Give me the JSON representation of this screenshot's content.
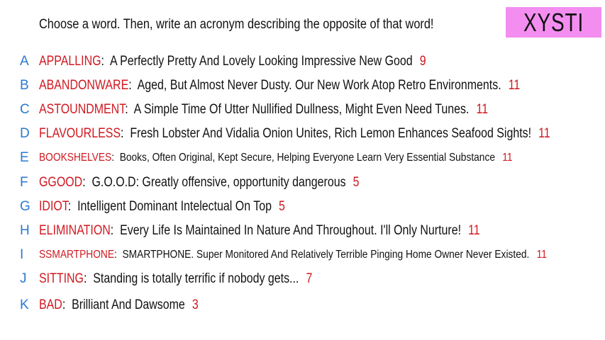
{
  "prompt": "Choose a word. Then, write an acronym describing the opposite of that word!",
  "badge": "XYSTI",
  "colors": {
    "badge": "#f38ef0",
    "letter": "#2a7ad1",
    "word": "#d01820"
  },
  "entries": [
    {
      "letter": "A",
      "word": "APPALLING",
      "acronym": "A Perfectly Pretty And Lovely Looking Impressive New Good",
      "score": "9"
    },
    {
      "letter": "B",
      "word": "ABANDONWARE",
      "acronym": "Aged, But Almost Never Dusty. Our New Work Atop Retro Environments.",
      "score": "11"
    },
    {
      "letter": "C",
      "word": "ASTOUNDMENT",
      "acronym": "A Simple Time Of Utter Nullified Dullness, Might Even Need Tunes.",
      "score": "11"
    },
    {
      "letter": "D",
      "word": "FLAVOURLESS",
      "acronym": "Fresh Lobster And Vidalia Onion Unites, Rich Lemon Enhances Seafood Sights!",
      "score": "11"
    },
    {
      "letter": "E",
      "word": "BOOKSHELVES",
      "acronym": "Books, Often Original, Kept Secure, Helping Everyone Learn Very Essential Substance",
      "score": "11"
    },
    {
      "letter": "F",
      "word": "GGOOD",
      "acronym": "G.O.O.D: Greatly offensive, opportunity dangerous",
      "score": "5"
    },
    {
      "letter": "G",
      "word": "IDIOT",
      "acronym": "Intelligent Dominant Intelectual On Top",
      "score": "5"
    },
    {
      "letter": "H",
      "word": "ELIMINATION",
      "acronym": "Every Life Is Maintained In Nature And Throughout. I'll Only Nurture!",
      "score": "11"
    },
    {
      "letter": "I",
      "word": "SSMARTPHONE",
      "acronym": "SMARTPHONE. Super Monitored And Relatively Terrible Pinging Home Owner Never Existed.",
      "score": "11"
    },
    {
      "letter": "J",
      "word": "SITTING",
      "acronym": "Standing is totally terrific if nobody gets...",
      "score": "7"
    },
    {
      "letter": "K",
      "word": "BAD",
      "acronym": "Brilliant And Dawsome",
      "score": "3"
    }
  ]
}
